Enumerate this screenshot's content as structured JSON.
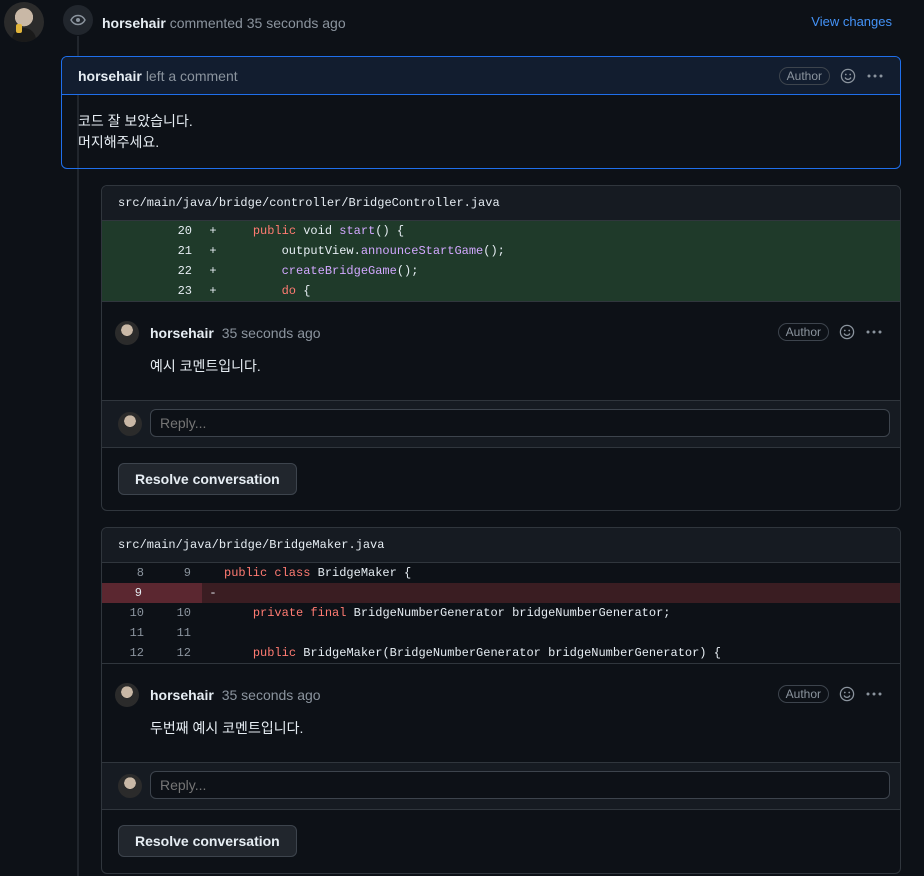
{
  "timeline": {
    "author": "horsehair",
    "action": "commented",
    "time": "35 seconds ago",
    "view_changes": "View changes"
  },
  "review": {
    "author": "horsehair",
    "action": "left a comment",
    "badge": "Author",
    "line1": "코드 잘 보았습니다.",
    "line2": "머지해주세요."
  },
  "threads": [
    {
      "file": "src/main/java/bridge/controller/BridgeController.java",
      "comment": {
        "author": "horsehair",
        "time": "35 seconds ago",
        "badge": "Author",
        "body": "예시 코멘트입니다."
      },
      "reply_placeholder": "Reply...",
      "resolve_label": "Resolve conversation"
    },
    {
      "file": "src/main/java/bridge/BridgeMaker.java",
      "comment": {
        "author": "horsehair",
        "time": "35 seconds ago",
        "badge": "Author",
        "body": "두번째 예시 코멘트입니다."
      },
      "reply_placeholder": "Reply...",
      "resolve_label": "Resolve conversation"
    }
  ],
  "diff1": [
    {
      "ln": "20",
      "mark": "+",
      "code": "    public void start() {"
    },
    {
      "ln": "21",
      "mark": "+",
      "code": "        outputView.announceStartGame();"
    },
    {
      "ln": "22",
      "mark": "+",
      "code": "        createBridgeGame();"
    },
    {
      "ln": "23",
      "mark": "+",
      "code": "        do {"
    }
  ],
  "diff2": [
    {
      "old": "8",
      "new": "9",
      "mark": "",
      "code": "public class BridgeMaker {"
    },
    {
      "old": "9",
      "new": "",
      "mark": "-",
      "code": ""
    },
    {
      "old": "10",
      "new": "10",
      "mark": "",
      "code": "    private final BridgeNumberGenerator bridgeNumberGenerator;"
    },
    {
      "old": "11",
      "new": "11",
      "mark": "",
      "code": ""
    },
    {
      "old": "12",
      "new": "12",
      "mark": "",
      "code": "    public BridgeMaker(BridgeNumberGenerator bridgeNumberGenerator) {"
    }
  ],
  "icons": {
    "eye": "eye-icon",
    "smile": "smiley-icon",
    "kebab": "kebab-horizontal-icon"
  }
}
